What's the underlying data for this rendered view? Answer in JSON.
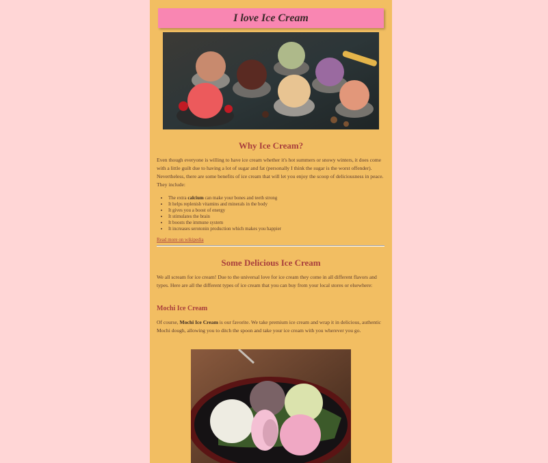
{
  "header": {
    "title": "I love Ice Cream"
  },
  "why": {
    "heading": "Why Ice Cream?",
    "intro": "Even though everyone is willing to have ice cream whether it's hot summers or snowy winters, it does come with a little guilt due to having a lot of sugar and fat (personally I think the sugar is the worst offender). Nevertheless, there are some benefits of ice cream that will let you enjoy the scoop of deliciousness in peace. They include:",
    "benefits": [
      {
        "before": "The extra ",
        "bold": "calcium",
        "after": " can make your bones and teeth strong"
      },
      {
        "text": "It helps replenish vitamins and minerals in the body"
      },
      {
        "text": "It gives you a boost of energy"
      },
      {
        "text": "It stimulates the brain"
      },
      {
        "text": "It boosts the immune system"
      },
      {
        "text": "It increases serotonin production which makes you happier"
      }
    ],
    "link_label": "Read more on wikipedia"
  },
  "delicious": {
    "heading": "Some Delicious Ice Cream",
    "intro": "We all scream for ice cream! Due to the universal love for ice cream they come in all different flavors and types. Here are all the different types of ice cream that you can buy from your local stores or elsewhere:",
    "mochi": {
      "heading": "Mochi Ice Cream",
      "text_before": "Of course, ",
      "text_bold": "Mochi Ice Cream",
      "text_after": " is our favorite. We take premium ice cream and wrap it in delicious, authentic Mochi dough, allowing you to ditch the spoon and take your ice cream with you wherever you go."
    }
  },
  "colors": {
    "page_bg": "#ffd6d6",
    "column_bg": "#f2be62",
    "banner_bg": "#f986b2",
    "heading": "#a83e3c"
  }
}
